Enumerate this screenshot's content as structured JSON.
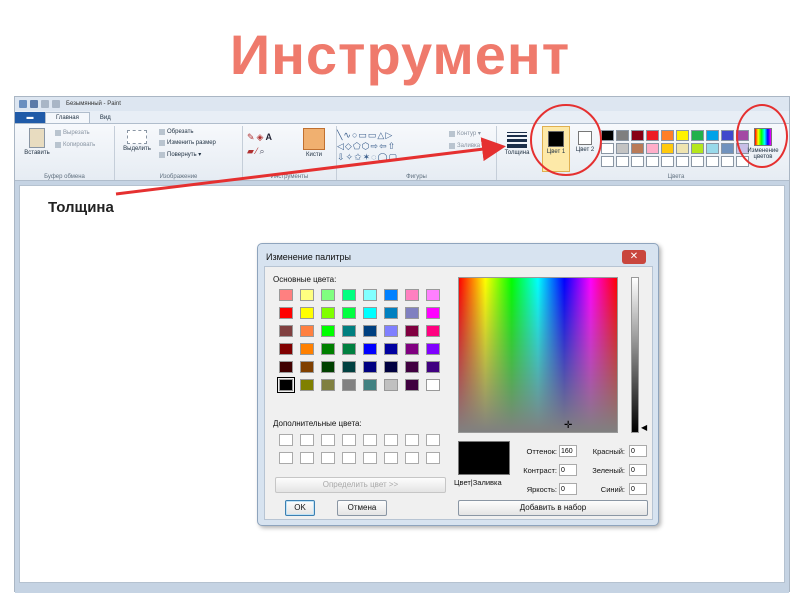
{
  "slide_title": "Инструмент",
  "annotation": "Толщина",
  "paint": {
    "window_title": "Безымянный - Paint",
    "file_tab": "▬",
    "tabs": [
      "Главная",
      "Вид"
    ],
    "clipboard": {
      "paste": "Вставить",
      "cut": "Вырезать",
      "copy": "Копировать",
      "label": "Буфер обмена"
    },
    "image": {
      "select": "Выделить",
      "crop": "Обрезать",
      "resize": "Изменить размер",
      "rotate": "Повернуть ▾",
      "label": "Изображение"
    },
    "tools": {
      "brushes": "Кисти",
      "label": "Инструменты"
    },
    "shapes": {
      "outline": "Контур ▾",
      "fill": "Заливка ▾",
      "label": "Фигуры"
    },
    "thickness_label": "Толщина",
    "color1": "Цвет 1",
    "color2": "Цвет 2",
    "edit_colors": "Изменение цветов",
    "colors_label": "Цвета",
    "palette": [
      "#000000",
      "#7f7f7f",
      "#880015",
      "#ed1c24",
      "#ff7f27",
      "#fff200",
      "#22b14c",
      "#00a2e8",
      "#3f48cc",
      "#a349a4",
      "#ffffff",
      "#c3c3c3",
      "#b97a57",
      "#ffaec9",
      "#ffc90e",
      "#efe4b0",
      "#b5e61d",
      "#99d9ea",
      "#7092be",
      "#c8bfe7",
      "#ffffff",
      "#ffffff",
      "#ffffff",
      "#ffffff",
      "#ffffff",
      "#ffffff",
      "#ffffff",
      "#ffffff",
      "#ffffff",
      "#ffffff"
    ]
  },
  "dialog": {
    "title": "Изменение палитры",
    "close": "✕",
    "basic_colors_label": "Основные цвета:",
    "basic_colors": [
      "#ff8080",
      "#ffff80",
      "#80ff80",
      "#00ff80",
      "#80ffff",
      "#0080ff",
      "#ff80c0",
      "#ff80ff",
      "#ff0000",
      "#ffff00",
      "#80ff00",
      "#00ff40",
      "#00ffff",
      "#0080c0",
      "#8080c0",
      "#ff00ff",
      "#804040",
      "#ff8040",
      "#00ff00",
      "#008080",
      "#004080",
      "#8080ff",
      "#800040",
      "#ff0080",
      "#800000",
      "#ff8000",
      "#008000",
      "#008040",
      "#0000ff",
      "#0000a0",
      "#800080",
      "#8000ff",
      "#400000",
      "#804000",
      "#004000",
      "#004040",
      "#000080",
      "#000040",
      "#400040",
      "#400080",
      "#000000",
      "#808000",
      "#808040",
      "#808080",
      "#408080",
      "#c0c0c0",
      "#400040",
      "#ffffff"
    ],
    "custom_colors_label": "Дополнительные цвета:",
    "define_button": "Определить цвет >>",
    "ok": "OK",
    "cancel": "Отмена",
    "swatch_label": "Цвет|Заливка",
    "hue_label": "Оттенок:",
    "hue": "160",
    "sat_label": "Контраст:",
    "sat": "0",
    "lum_label": "Яркость:",
    "lum": "0",
    "red_label": "Красный:",
    "red": "0",
    "green_label": "Зеленый:",
    "green": "0",
    "blue_label": "Синий:",
    "blue": "0",
    "add_button": "Добавить в набор"
  }
}
